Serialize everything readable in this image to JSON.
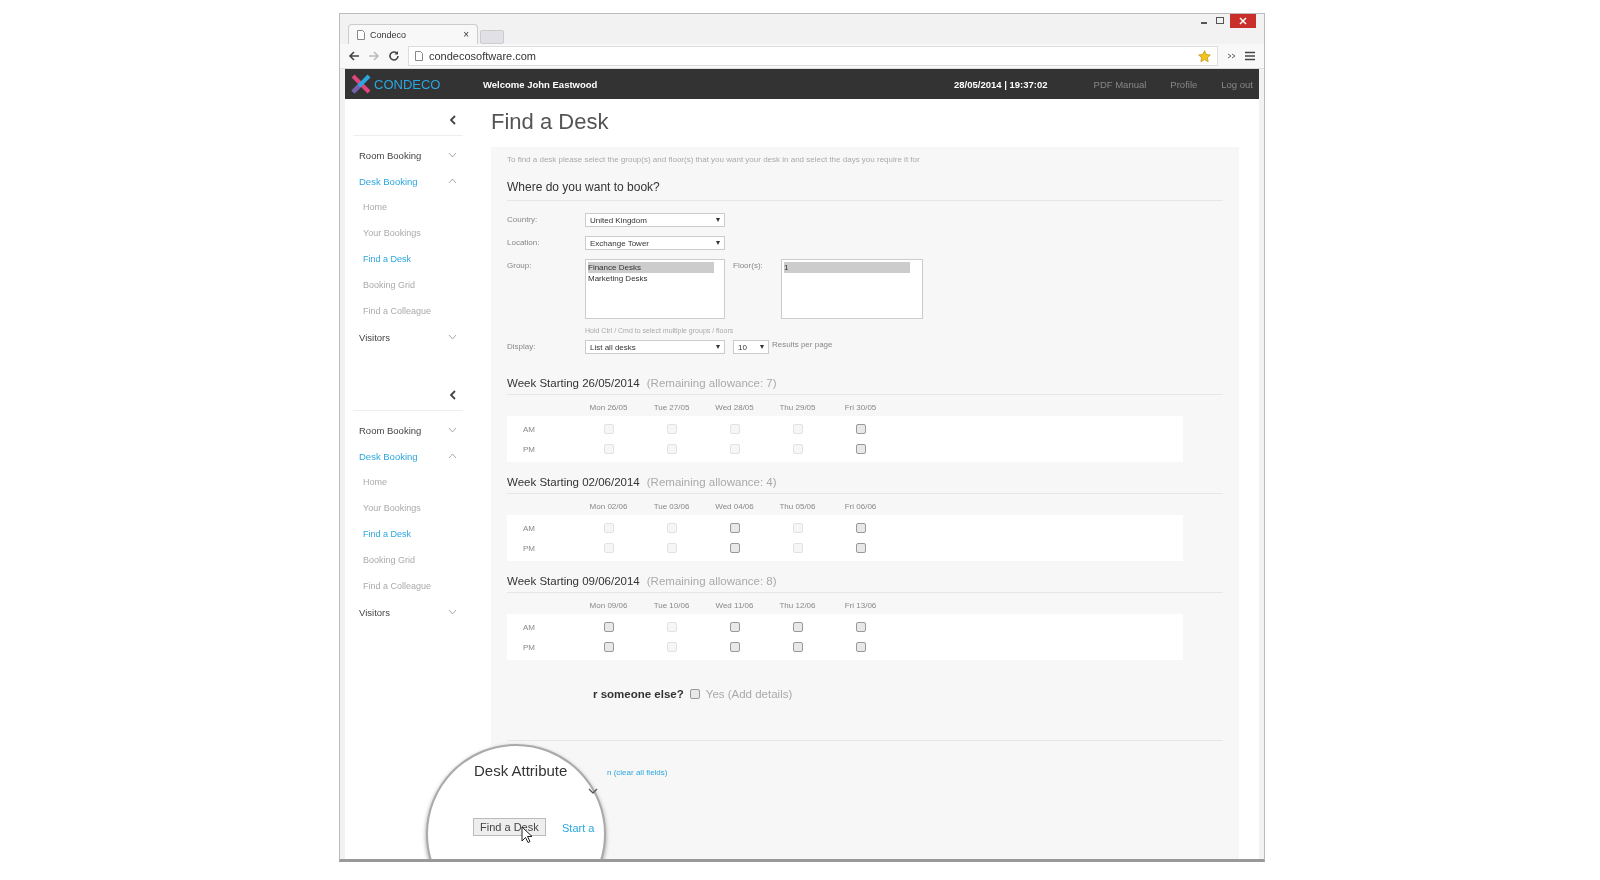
{
  "browser": {
    "tab_title": "Condeco",
    "tab_close": "×",
    "url": "condecosoftware.com"
  },
  "header": {
    "logo": "CONDECO",
    "welcome": "Welcome John Eastwood",
    "datetime": "28/05/2014 | 19:37:02",
    "links": [
      "PDF Manual",
      "Profile",
      "Log out"
    ]
  },
  "sidebars": [
    {
      "items": [
        {
          "label": "Room Booking",
          "expanded": false,
          "selected": false
        },
        {
          "label": "Desk Booking",
          "expanded": true,
          "selected": true,
          "children": [
            {
              "label": "Home",
              "selected": false
            },
            {
              "label": "Your Bookings",
              "selected": false
            },
            {
              "label": "Find a Desk",
              "selected": true
            },
            {
              "label": "Booking Grid",
              "selected": false
            },
            {
              "label": "Find a Colleague",
              "selected": false
            }
          ]
        },
        {
          "label": "Visitors",
          "expanded": false,
          "selected": false
        }
      ]
    },
    {
      "items": [
        {
          "label": "Room Booking",
          "expanded": false,
          "selected": false
        },
        {
          "label": "Desk Booking",
          "expanded": true,
          "selected": true,
          "children": [
            {
              "label": "Home",
              "selected": false
            },
            {
              "label": "Your Bookings",
              "selected": false
            },
            {
              "label": "Find a Desk",
              "selected": true
            },
            {
              "label": "Booking Grid",
              "selected": false
            },
            {
              "label": "Find a Colleague",
              "selected": false
            }
          ]
        },
        {
          "label": "Visitors",
          "expanded": false,
          "selected": false
        }
      ]
    }
  ],
  "page_title": "Find a Desk",
  "intro": "To find a desk please select the group(s) and floor(s) that you want your desk in and select the days you require it for",
  "form": {
    "heading": "Where do you want to book?",
    "country": {
      "label": "Country:",
      "value": "United Kingdom"
    },
    "location": {
      "label": "Location:",
      "value": "Exchange Tower"
    },
    "group": {
      "label": "Group:",
      "options": [
        {
          "label": "Finance Desks",
          "selected": true
        },
        {
          "label": "Marketing Desks",
          "selected": false
        }
      ]
    },
    "floors": {
      "label": "Floor(s):",
      "options": [
        {
          "label": "1",
          "selected": true
        }
      ]
    },
    "hint": "Hold Ctrl / Cmd to select multiple groups / floors",
    "display": {
      "label": "Display:",
      "value": "List all desks",
      "per_page": "10",
      "per_page_label": "Results per page"
    }
  },
  "weeks": [
    {
      "title": "Week Starting 26/05/2014",
      "allowance": "(Remaining allowance: 7)",
      "slots": [
        "AM",
        "PM"
      ],
      "days": [
        {
          "label": "Mon 26/05",
          "am_disabled": true,
          "pm_disabled": true
        },
        {
          "label": "Tue 27/05",
          "am_disabled": true,
          "pm_disabled": true
        },
        {
          "label": "Wed 28/05",
          "am_disabled": true,
          "pm_disabled": true
        },
        {
          "label": "Thu 29/05",
          "am_disabled": true,
          "pm_disabled": true
        },
        {
          "label": "Fri 30/05",
          "am_disabled": false,
          "pm_disabled": false
        }
      ]
    },
    {
      "title": "Week Starting 02/06/2014",
      "allowance": "(Remaining allowance: 4)",
      "slots": [
        "AM",
        "PM"
      ],
      "days": [
        {
          "label": "Mon 02/06",
          "am_disabled": true,
          "pm_disabled": true
        },
        {
          "label": "Tue 03/06",
          "am_disabled": true,
          "pm_disabled": true
        },
        {
          "label": "Wed 04/06",
          "am_disabled": false,
          "pm_disabled": false
        },
        {
          "label": "Thu 05/06",
          "am_disabled": true,
          "pm_disabled": true
        },
        {
          "label": "Fri 06/06",
          "am_disabled": false,
          "pm_disabled": false
        }
      ]
    },
    {
      "title": "Week Starting 09/06/2014",
      "allowance": "(Remaining allowance: 8)",
      "slots": [
        "AM",
        "PM"
      ],
      "days": [
        {
          "label": "Mon 09/06",
          "am_disabled": false,
          "pm_disabled": false
        },
        {
          "label": "Tue 10/06",
          "am_disabled": true,
          "pm_disabled": true
        },
        {
          "label": "Wed 11/06",
          "am_disabled": false,
          "pm_disabled": false
        },
        {
          "label": "Thu 12/06",
          "am_disabled": false,
          "pm_disabled": false
        },
        {
          "label": "Fri 13/06",
          "am_disabled": false,
          "pm_disabled": false
        }
      ]
    }
  ],
  "someone_else": {
    "question": "r someone else?",
    "option": "Yes (Add details)",
    "checked": false
  },
  "clear_link": "n (clear all fields)",
  "magnifier": {
    "heading": "Desk  Attribute",
    "button": "Find a Desk",
    "link": "Start a"
  }
}
